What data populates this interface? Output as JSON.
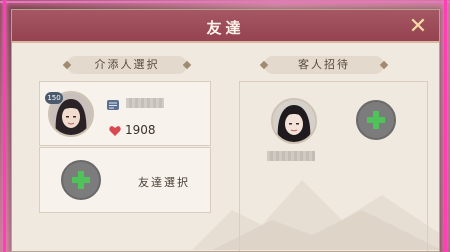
{
  "dialog": {
    "title": "友達",
    "close_icon": "close-x-icon"
  },
  "left_section": {
    "header": "介添人選択",
    "friend": {
      "level": "150",
      "icon": "scroll-icon",
      "intimacy_icon": "heart-icon",
      "intimacy_value": "1908"
    },
    "select_button_label": "友達選択"
  },
  "right_section": {
    "header": "客人招待",
    "guest_icon": "add-guest-icon"
  },
  "colors": {
    "titlebar": "#9c4c59",
    "panel_bg": "#efe9e0",
    "plus_green": "#4fc25a",
    "frame_pink": "#ff3fb5"
  }
}
